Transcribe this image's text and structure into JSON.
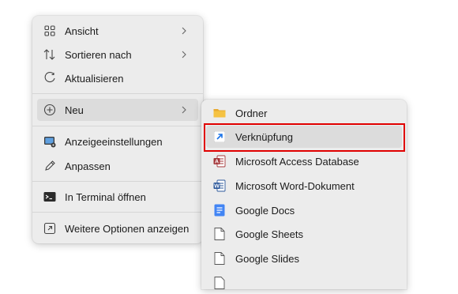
{
  "main_menu": {
    "items": [
      {
        "label": "Ansicht"
      },
      {
        "label": "Sortieren nach"
      },
      {
        "label": "Aktualisieren"
      },
      {
        "label": "Neu"
      },
      {
        "label": "Anzeigeeinstellungen"
      },
      {
        "label": "Anpassen"
      },
      {
        "label": "In Terminal öffnen"
      },
      {
        "label": "Weitere Optionen anzeigen"
      }
    ]
  },
  "sub_menu": {
    "items": [
      {
        "label": "Ordner"
      },
      {
        "label": "Verknüpfung"
      },
      {
        "label": "Microsoft Access Database"
      },
      {
        "label": "Microsoft Word-Dokument"
      },
      {
        "label": "Google Docs"
      },
      {
        "label": "Google Sheets"
      },
      {
        "label": "Google Slides"
      }
    ]
  },
  "colors": {
    "highlight_border": "#e00000",
    "access_red": "#a4373a",
    "word_blue": "#2b579a",
    "docs_blue": "#4285f4",
    "folder_yellow": "#f5c242"
  }
}
